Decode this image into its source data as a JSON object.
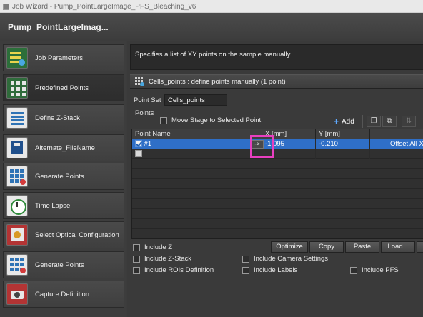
{
  "window": {
    "title": "Job Wizard - Pump_PointLargeImage_PFS_Bleaching_v6"
  },
  "header": {
    "job_title": "Pump_PointLargeImag..."
  },
  "sidebar": {
    "items": [
      {
        "label": "Job Parameters",
        "icon": "job-parameters-icon"
      },
      {
        "label": "Predefined Points",
        "icon": "predefined-points-icon"
      },
      {
        "label": "Define Z-Stack",
        "icon": "z-stack-icon"
      },
      {
        "label": "Alternate_FileName",
        "icon": "file-name-icon"
      },
      {
        "label": "Generate Points",
        "icon": "generate-points-icon"
      },
      {
        "label": "Time Lapse",
        "icon": "time-lapse-icon"
      },
      {
        "label": "Select Optical Configuration",
        "icon": "optical-config-icon"
      },
      {
        "label": "Generate Points",
        "icon": "generate-points-icon"
      },
      {
        "label": "Capture Definition",
        "icon": "capture-icon"
      }
    ],
    "active_index": 1
  },
  "main": {
    "description": "Specifies a list of XY points on the sample manually.",
    "section_title": "Cells_points : define points manually (1 point)",
    "point_set_label": "Point Set",
    "point_set_value": "Cells_points",
    "points_label": "Points",
    "move_stage_label": "Move Stage to Selected Point",
    "add_label": "Add",
    "table": {
      "columns": [
        "Point Name",
        "X [mm]",
        "Y [mm]"
      ],
      "rows": [
        {
          "checked": true,
          "name": "#1",
          "arrow": "->",
          "x": "-1.095",
          "y": "-0.210",
          "extra": "Offset All X"
        }
      ]
    },
    "options": {
      "include_z": "Include Z",
      "include_zstack": "Include Z-Stack",
      "include_rois": "Include ROIs Definition",
      "include_camera": "Include Camera Settings",
      "include_labels": "Include Labels",
      "include_pfs": "Include PFS"
    },
    "buttons": {
      "optimize": "Optimize",
      "copy": "Copy",
      "paste": "Paste",
      "load": "Load..."
    }
  }
}
